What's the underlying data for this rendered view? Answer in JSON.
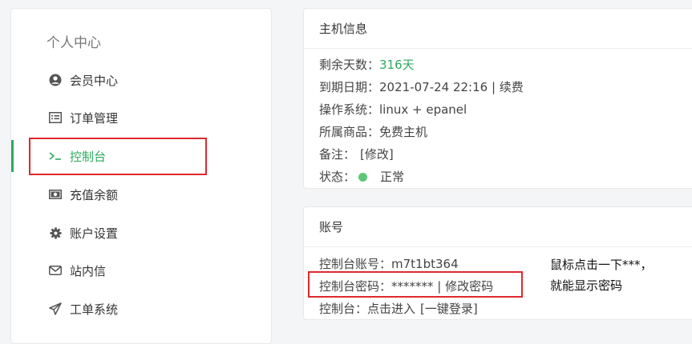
{
  "sidebar": {
    "title": "个人中心",
    "items": [
      {
        "label": "会员中心",
        "icon": "user-circle-icon"
      },
      {
        "label": "订单管理",
        "icon": "list-icon"
      },
      {
        "label": "控制台",
        "icon": "terminal-icon",
        "active": true
      },
      {
        "label": "充值余额",
        "icon": "money-icon"
      },
      {
        "label": "账户设置",
        "icon": "gear-icon"
      },
      {
        "label": "站内信",
        "icon": "mail-icon"
      },
      {
        "label": "工单系统",
        "icon": "paper-plane-icon"
      }
    ]
  },
  "host_info": {
    "title": "主机信息",
    "remaining_label": "剩余天数：",
    "remaining_value": "316天",
    "expiry_label": "到期日期：",
    "expiry_value": "2021-07-24 22:16",
    "separator": " | ",
    "renew_link": "续费",
    "os_label": "操作系统：",
    "os_value": "linux + epanel",
    "product_label": "所属商品：",
    "product_value": "免费主机",
    "remark_label": "备注：",
    "remark_edit": "[修改]",
    "status_label": "状态：",
    "status_value": "正常"
  },
  "account": {
    "title": "账号",
    "account_label": "控制台账号：",
    "account_value": "m7t1bt364",
    "password_label": "控制台密码：",
    "password_value": "*******",
    "separator": " | ",
    "change_password_link": "修改密码",
    "console_label": "控制台：",
    "console_enter_link": "点击进入",
    "console_login_link": "[一键登录]"
  },
  "annotation": {
    "line1": "鼠标点击一下***，",
    "line2": "就能显示密码"
  },
  "colors": {
    "accent_green": "#2eab5f",
    "highlight_red": "#e0282e",
    "status_dot": "#5cc77a"
  }
}
